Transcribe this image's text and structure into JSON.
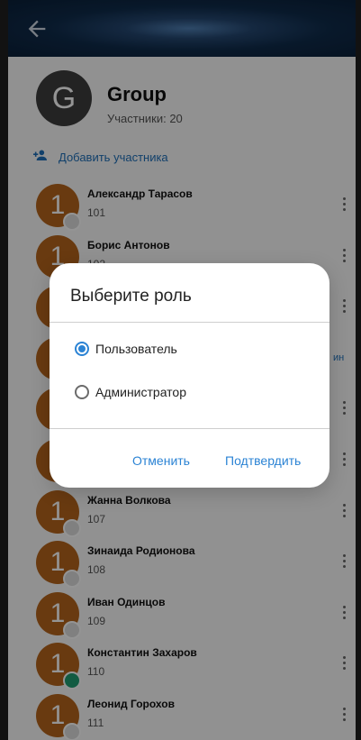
{
  "group": {
    "avatar_letter": "G",
    "name": "Group",
    "members_count": "Участники: 20"
  },
  "add_member_label": "Добавить участника",
  "members": [
    {
      "initial": "1",
      "name": "Александр Тарасов",
      "id": "101",
      "status": "offline"
    },
    {
      "initial": "1",
      "name": "Борис Антонов",
      "id": "102",
      "status": "offline"
    },
    {
      "initial": "1",
      "name": "",
      "id": "",
      "status": "offline"
    },
    {
      "initial": "1",
      "name": "",
      "id": "",
      "status": "offline",
      "extra": "ин"
    },
    {
      "initial": "1",
      "name": "",
      "id": "",
      "status": "offline"
    },
    {
      "initial": "1",
      "name": "",
      "id": "",
      "status": "offline"
    },
    {
      "initial": "1",
      "name": "Жанна Волкова",
      "id": "107",
      "status": "offline"
    },
    {
      "initial": "1",
      "name": "Зинаида Родионова",
      "id": "108",
      "status": "offline"
    },
    {
      "initial": "1",
      "name": "Иван Одинцов",
      "id": "109",
      "status": "offline"
    },
    {
      "initial": "1",
      "name": "Константин Захаров",
      "id": "110",
      "status": "online"
    },
    {
      "initial": "1",
      "name": "Леонид Горохов",
      "id": "111",
      "status": "offline"
    }
  ],
  "dialog": {
    "title": "Выберите роль",
    "options": [
      {
        "label": "Пользователь",
        "selected": true
      },
      {
        "label": "Администратор",
        "selected": false
      }
    ],
    "cancel_label": "Отменить",
    "confirm_label": "Подтвердить"
  },
  "icons": {
    "back": "arrow-left-icon",
    "add": "add-person-icon",
    "more": "more-vert-icon"
  },
  "colors": {
    "accent": "#2b83d4",
    "avatar_member": "#b5651d",
    "avatar_group": "#3d3d3d",
    "online": "#1f9d72"
  }
}
